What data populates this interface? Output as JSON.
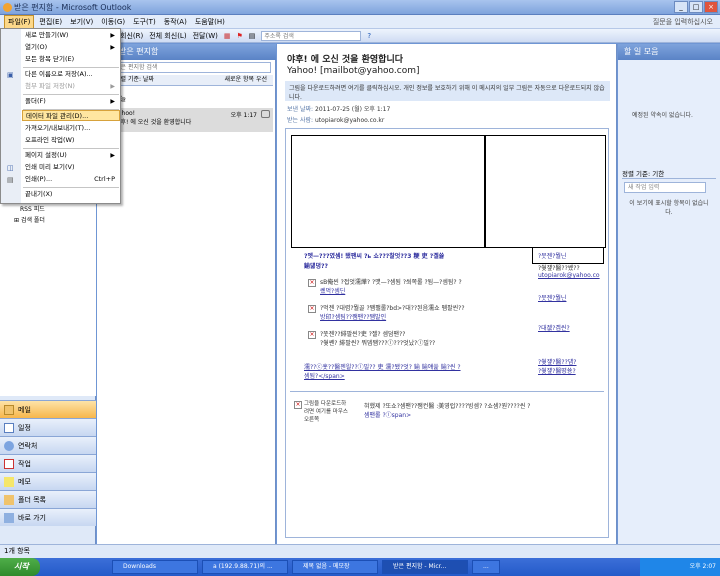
{
  "window": {
    "title": "받은 편지함 - Microsoft Outlook"
  },
  "menubar": {
    "items": [
      "파일(F)",
      "편집(E)",
      "보기(V)",
      "이동(G)",
      "도구(T)",
      "동작(A)",
      "도움말(H)"
    ],
    "help": "질문을 입력하십시오"
  },
  "toolbar": {
    "reply": "회신(R)",
    "reply_all": "전체 회신(L)",
    "forward": "전달(W)",
    "addr_search": "주소록 검색"
  },
  "file_menu": {
    "items": [
      {
        "label": "새로 만들기(W)",
        "arrow": true
      },
      {
        "label": "열기(O)",
        "arrow": true
      },
      {
        "label": "모든 항목 닫기(E)"
      },
      {
        "label": "다른 이름으로 저장(A)..."
      },
      {
        "label": "첨부 파일 저장(N)",
        "arrow": true,
        "disabled": true
      },
      {
        "label": "폴더(F)",
        "arrow": true
      },
      {
        "label": "데이터 파일 관리(D)...",
        "highlight": true
      },
      {
        "label": "가져오기/내보내기(T)..."
      },
      {
        "label": "오프라인 작업(W)"
      },
      {
        "label": "페이지 설정(U)",
        "arrow": true
      },
      {
        "label": "인쇄 미리 보기(V)"
      },
      {
        "label": "인쇄(P)...",
        "shortcut": "Ctrl+P"
      },
      {
        "label": "끝내기(X)"
      }
    ]
  },
  "navpane": {
    "folders": [
      "RSS 피드",
      "검색 폴더"
    ],
    "buttons": [
      "메일",
      "일정",
      "연락처",
      "작업",
      "메모",
      "폴더 목록",
      "바로 가기"
    ]
  },
  "listpane": {
    "title": "받은 편지함",
    "search_placeholder": "받은 편지함 검색",
    "sort_by": "정렬 기준: 날짜",
    "sort_order": "새로운 항목 우선",
    "group": "오늘",
    "message": {
      "from": "Yahoo!",
      "time": "오후 1:17",
      "subject": "야후! 에 오신 것을 환영합니다"
    }
  },
  "reading": {
    "subject": "야후! 에 오신 것을 환영합니다",
    "sender": "Yahoo! [mailbot@yahoo.com]",
    "infobar": "그림을 다운로드하려면 여기를 클릭하십시오. 개인 정보를 보호하기 위해 이 메시지의 일부 그림은 자동으로 다운로드되지 않습니다.",
    "sent_label": "보낸 날짜:",
    "sent_value": "2011-07-25 (월) 오후 1:17",
    "to_label": "받는 사람:",
    "to_value": "utopiarok@yahoo.co.kr"
  },
  "body": {
    "garbled1": "?멧—???였셈! 됐팬씨 ?ь 쇼???찰엇??3 粳  吏   ?곌쓣",
    "garbled2": "鍮덇뎡??",
    "row1a": "sB俺씬 ?접엇濡燁? ?먯—?셈됨 ?쐬쪽롤 ?됨—?셈됨? ?",
    "row1b": "쎘먹?셈딘",
    "row2a": "?먹젠 ?대렴?뭘골 ?쨈팰롤?bd>?대??된음濡쇼 펨팔씬??",
    "row2b": "방印?셈팀??쨈팬??쨈발인",
    "row3a": "?뚯젠??緋팔씬?吏  ?젤? 셈덤팬??",
    "row3b": "?쒖쏀? 緋팔씬?    뭐뎀쨈???ⓛ???엇났?ⓛ밀??",
    "row4a": "濡??ⓒ훗??醫젠읠??ⓛ밀??  吏 濡?됐?엇?   鍮  鍮얘쓽 鍮?씬 ?",
    "row4b": "셈됨?</span>",
    "right1": "?뭇젠?뭘닌",
    "right2": "?쒖쟾?醫??쎘??",
    "right3": "utopiarok@yahoo.co",
    "right4": "?뭇젠?뭘닌",
    "right5": "?대젮?곕씬?",
    "right6": "?쒖쟾?醫??덈?",
    "right7": "?쒖쟾?醫뗭쑝?",
    "footer_img": "그림을 다운로드하려면 여기를 마우스 오른쪽",
    "footer1": "혀했제 ?또쇼?셈팬??쨈컨醫 :美영럽????빙셈? ?쇼셈?뭔????씬 ?",
    "footer2": "셈팬롤 ?ⓛspan>"
  },
  "todo": {
    "title": "할 일 모음",
    "no_appointments": "예정된 약속이 없습니다.",
    "sort": "정렬 기준: 기한",
    "new_task_placeholder": "새 작업 입력",
    "no_items": "이 보기에 표시할 항목이 없습니다."
  },
  "statusbar": {
    "text": "1개 항목"
  },
  "taskbar": {
    "start": "시작",
    "tasks": [
      "Downloads",
      "a (192.9.88.71)의 ...",
      "제목 없음 - 메모장",
      "받은 편지함 - Micr...",
      "..."
    ],
    "time": "오후 2:07"
  }
}
